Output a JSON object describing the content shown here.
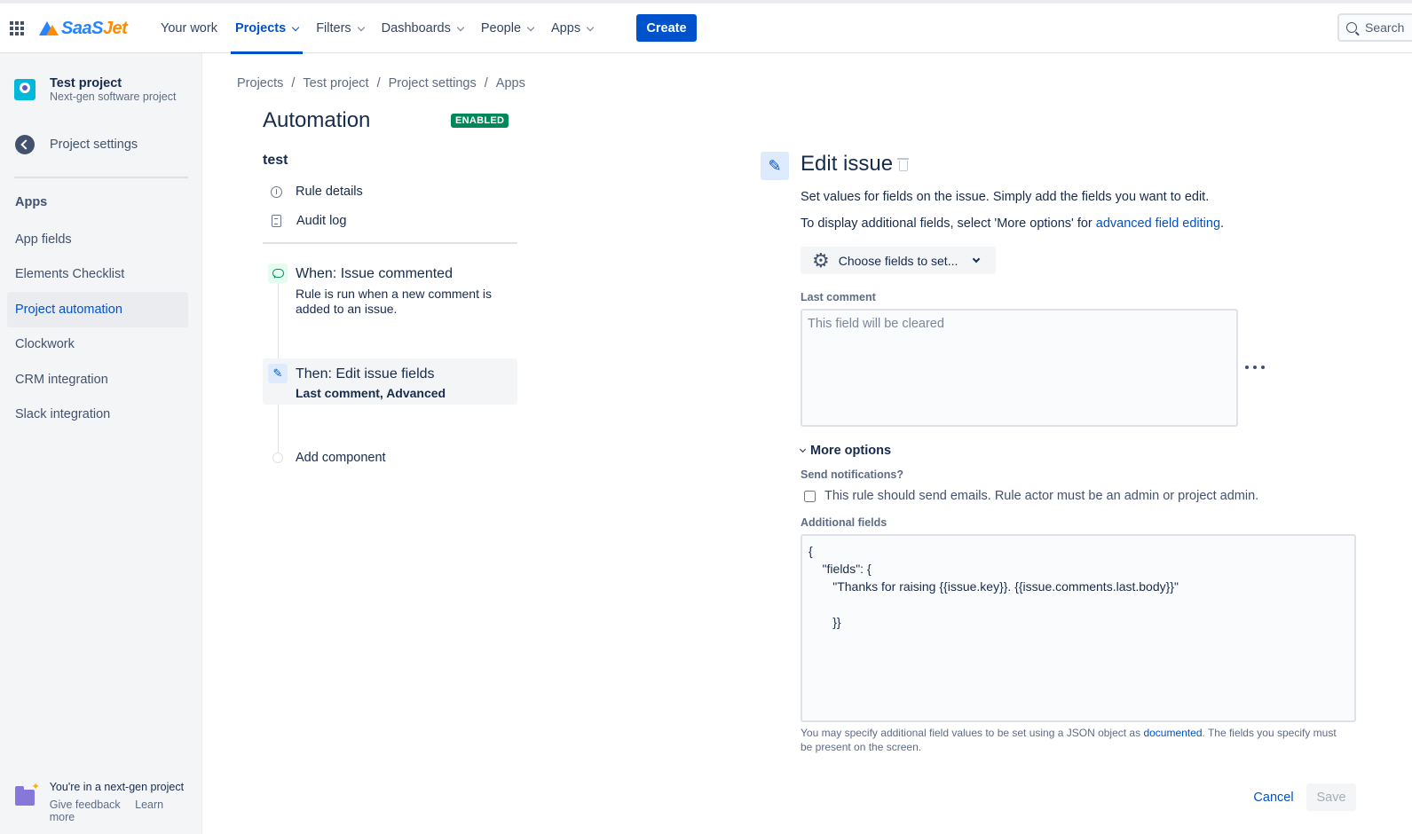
{
  "topnav": {
    "logo_left": "Saa",
    "logo_mid": "S",
    "logo_right": "Jet",
    "items": [
      {
        "label": "Your work",
        "has_dropdown": false
      },
      {
        "label": "Projects",
        "has_dropdown": true,
        "active": true
      },
      {
        "label": "Filters",
        "has_dropdown": true
      },
      {
        "label": "Dashboards",
        "has_dropdown": true
      },
      {
        "label": "People",
        "has_dropdown": true
      },
      {
        "label": "Apps",
        "has_dropdown": true
      }
    ],
    "create_label": "Create",
    "search_placeholder": "Search"
  },
  "sidebar": {
    "project_name": "Test project",
    "project_type": "Next-gen software project",
    "back_label": "Project settings",
    "section_title": "Apps",
    "items": [
      {
        "label": "App fields"
      },
      {
        "label": "Elements Checklist"
      },
      {
        "label": "Project automation",
        "active": true
      },
      {
        "label": "Clockwork"
      },
      {
        "label": "CRM integration"
      },
      {
        "label": "Slack integration"
      }
    ],
    "footer_title": "You're in a next-gen project",
    "footer_link_feedback": "Give feedback",
    "footer_link_learn": "Learn more"
  },
  "breadcrumb": [
    "Projects",
    "Test project",
    "Project settings",
    "Apps"
  ],
  "automation": {
    "title": "Automation",
    "status_badge": "ENABLED",
    "rule_name": "test",
    "rule_details_label": "Rule details",
    "audit_log_label": "Audit log",
    "trigger_title": "When: Issue commented",
    "trigger_desc": "Rule is run when a new comment is added to an issue.",
    "action_title": "Then: Edit issue fields",
    "action_sub_a": "Last comment",
    "action_sub_sep": ", ",
    "action_sub_b": "Advanced",
    "add_component_label": "Add component"
  },
  "edit_issue": {
    "title": "Edit issue",
    "desc_1": "Set values for fields on the issue. Simply add the fields you want to edit.",
    "desc_2_prefix": "To display additional fields, select 'More options' for ",
    "desc_2_link": "advanced field editing",
    "desc_2_suffix": ".",
    "choose_fields_label": "Choose fields to set...",
    "last_comment_label": "Last comment",
    "last_comment_placeholder": "This field will be cleared",
    "more_options_label": "More options",
    "send_notifications_label": "Send notifications?",
    "send_notifications_checkbox": "This rule should send emails. Rule actor must be an admin or project admin.",
    "send_notifications_checked": false,
    "additional_fields_label": "Additional fields",
    "additional_fields_value": "{\n    \"fields\": {\n       \"Thanks for raising {{issue.key}}. {{issue.comments.last.body}}\"\n\n       }}",
    "help_prefix": "You may specify additional field values to be set using a JSON object as ",
    "help_link": "documented",
    "help_suffix": ". The fields you specify must be present on the screen.",
    "cancel_label": "Cancel",
    "save_label": "Save"
  },
  "colors": {
    "brand_blue": "#0052cc",
    "enabled_green": "#00875a",
    "logo_orange": "#ff8b00"
  }
}
